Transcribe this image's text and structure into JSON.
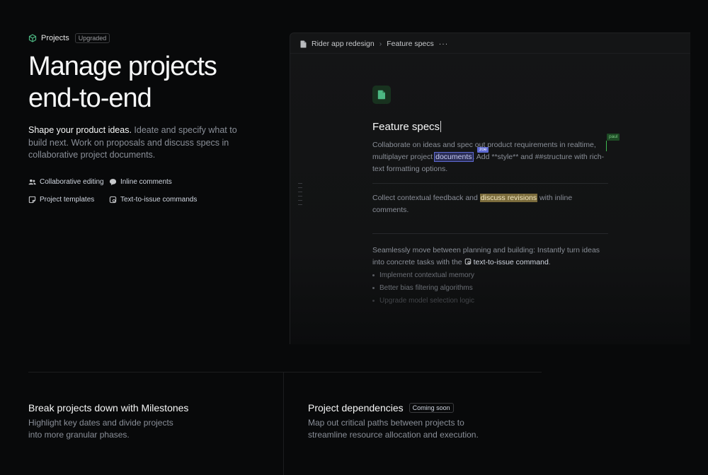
{
  "hero": {
    "eyebrow": "Projects",
    "badge": "Upgraded",
    "headline": "Manage projects end-to-end",
    "lede_strong": "Shape your product ideas.",
    "lede_rest": " Ideate and specify what to build next. Work on proposals and discuss specs in collaborative project documents.",
    "features": [
      {
        "label": "Collaborative editing",
        "icon": "people-icon"
      },
      {
        "label": "Inline comments",
        "icon": "comment-icon"
      },
      {
        "label": "Project templates",
        "icon": "template-icon"
      },
      {
        "label": "Text-to-issue commands",
        "icon": "issue-command-icon"
      }
    ]
  },
  "editor": {
    "breadcrumb": [
      "Rider app redesign",
      "Feature specs"
    ],
    "more": "···",
    "title": "Feature specs",
    "p1": {
      "a": "Collaborate on ideas and spec out product requirements in realtime, multiplayer project ",
      "highlight": "documents",
      "b": ". Add **style** and ##structure with rich-text formatting options.",
      "cursor_zoe": "zoe",
      "cursor_paul": "paul"
    },
    "p2": {
      "a": "Collect contextual feedback and ",
      "highlight": "discuss revisions",
      "b": " with inline comments."
    },
    "p3": {
      "a": "Seamlessly move between planning and building: Instantly turn ideas into concrete tasks with the ",
      "command": "text-to-issue command",
      "b": "."
    },
    "list": [
      "Implement contextual memory",
      "Better bias filtering algorithms",
      "Upgrade model selection logic"
    ]
  },
  "cards": [
    {
      "title": "Break projects down with Milestones",
      "body": "Highlight key dates and divide projects into more granular phases.",
      "badge": ""
    },
    {
      "title": "Project dependencies",
      "body": "Map out critical paths between projects to streamline resource allocation and execution.",
      "badge": "Coming soon"
    }
  ],
  "colors": {
    "background": "#08090a",
    "accent": "#5e6ad2",
    "green": "#3fb950",
    "highlight_gold": "#7b6c3c"
  }
}
